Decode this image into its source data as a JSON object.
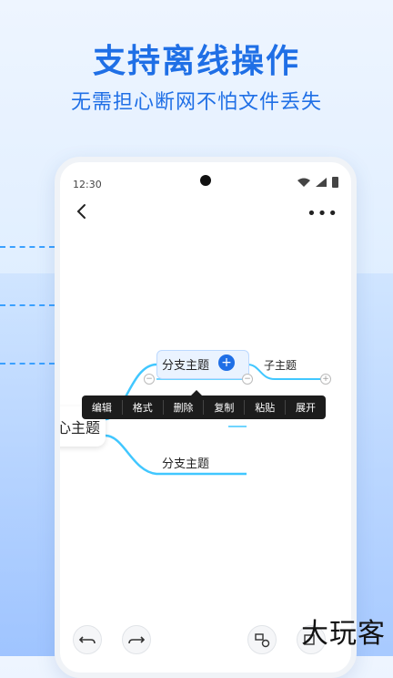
{
  "promo": {
    "headline": "支持离线操作",
    "subline": "无需担心断网不怕文件丢失"
  },
  "status_bar": {
    "time": "12:30"
  },
  "toolbar": {
    "back_icon": "chevron-left-icon",
    "more_label": "•••"
  },
  "mindmap": {
    "central_topic": "心主题",
    "branch_1": "分支主题",
    "subtopic": "子主题",
    "branch_2": "分支主题",
    "plus_label": "+",
    "handle_label": "−",
    "handle_plus_label": "+"
  },
  "context_menu": {
    "items": [
      "编辑",
      "格式",
      "删除",
      "复制",
      "粘贴",
      "展开"
    ]
  },
  "bottom_toolbar": {
    "icons": [
      "undo-icon",
      "redo-icon",
      "insert-node-icon",
      "insert-sibling-icon"
    ]
  },
  "watermark": {
    "text": "大玩客"
  },
  "colors": {
    "brand_blue": "#1f6fe6",
    "branch_line": "#41c7ff",
    "menu_bg": "#1c1c1c"
  }
}
